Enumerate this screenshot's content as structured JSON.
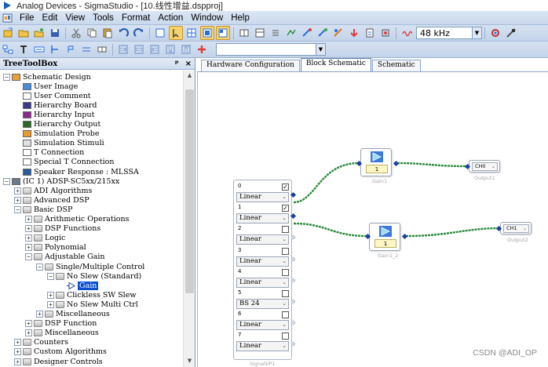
{
  "window": {
    "title": "Analog Devices - SigmaStudio - [10.线性增益.dspproj]"
  },
  "menu": [
    "File",
    "Edit",
    "View",
    "Tools",
    "Format",
    "Action",
    "Window",
    "Help"
  ],
  "toolbar": {
    "sample_rate": "48 kHz"
  },
  "left_panel": {
    "title": "TreeToolBox",
    "pin_label": "ᵖ",
    "close_label": "×",
    "tree": [
      {
        "label": "Schematic Design",
        "depth": 0,
        "exp": "-",
        "icon": "design-icon"
      },
      {
        "label": "User Image",
        "depth": 1,
        "exp": "",
        "icon": "image-icon"
      },
      {
        "label": "User Comment",
        "depth": 1,
        "exp": "",
        "icon": "comment-icon"
      },
      {
        "label": "Hierarchy Board",
        "depth": 1,
        "exp": "",
        "icon": "hierarchy-board-icon"
      },
      {
        "label": "Hierarchy Input",
        "depth": 1,
        "exp": "",
        "icon": "hierarchy-input-icon"
      },
      {
        "label": "Hierarchy Output",
        "depth": 1,
        "exp": "",
        "icon": "hierarchy-output-icon"
      },
      {
        "label": "Simulation Probe",
        "depth": 1,
        "exp": "",
        "icon": "probe-icon"
      },
      {
        "label": "Simulation Stimuli",
        "depth": 1,
        "exp": "",
        "icon": "stimuli-icon"
      },
      {
        "label": "T Connection",
        "depth": 1,
        "exp": "",
        "icon": "t-connection-icon"
      },
      {
        "label": "Special T Connection",
        "depth": 1,
        "exp": "",
        "icon": "t-connection-icon"
      },
      {
        "label": "Speaker Response : MLSSA",
        "depth": 1,
        "exp": "",
        "icon": "speaker-icon"
      },
      {
        "label": "(IC 1) ADSP-SC5xx/215xx",
        "depth": 0,
        "exp": "-",
        "icon": "chip-icon"
      },
      {
        "label": "ADI Algorithms",
        "depth": 1,
        "exp": "+",
        "icon": "folder-icon"
      },
      {
        "label": "Advanced DSP",
        "depth": 1,
        "exp": "+",
        "icon": "folder-icon"
      },
      {
        "label": "Basic DSP",
        "depth": 1,
        "exp": "-",
        "icon": "folder-icon"
      },
      {
        "label": "Arithmetic Operations",
        "depth": 2,
        "exp": "+",
        "icon": "folder-icon"
      },
      {
        "label": "DSP Functions",
        "depth": 2,
        "exp": "+",
        "icon": "folder-icon"
      },
      {
        "label": "Logic",
        "depth": 2,
        "exp": "+",
        "icon": "folder-icon"
      },
      {
        "label": "Polynomial",
        "depth": 2,
        "exp": "+",
        "icon": "folder-icon"
      },
      {
        "label": "Adjustable Gain",
        "depth": 2,
        "exp": "-",
        "icon": "folder-icon"
      },
      {
        "label": "Single/Multiple Control",
        "depth": 3,
        "exp": "-",
        "icon": "folder-icon"
      },
      {
        "label": "No Slew (Standard)",
        "depth": 4,
        "exp": "-",
        "icon": "folder-icon"
      },
      {
        "label": "Gain",
        "depth": 5,
        "exp": "",
        "icon": "gain-icon",
        "selected": true
      },
      {
        "label": "Clickless SW Slew",
        "depth": 4,
        "exp": "+",
        "icon": "folder-icon"
      },
      {
        "label": "No Slew Multi Ctrl",
        "depth": 4,
        "exp": "+",
        "icon": "folder-icon"
      },
      {
        "label": "Miscellaneous",
        "depth": 3,
        "exp": "+",
        "icon": "folder-icon"
      },
      {
        "label": "DSP Function",
        "depth": 2,
        "exp": "+",
        "icon": "folder-icon"
      },
      {
        "label": "Miscellaneous",
        "depth": 2,
        "exp": "+",
        "icon": "folder-icon"
      },
      {
        "label": "Counters",
        "depth": 1,
        "exp": "+",
        "icon": "folder-icon"
      },
      {
        "label": "Custom Algorithms",
        "depth": 1,
        "exp": "+",
        "icon": "folder-icon"
      },
      {
        "label": "Designer Controls",
        "depth": 1,
        "exp": "+",
        "icon": "folder-icon"
      }
    ]
  },
  "tabs": [
    {
      "label": "Hardware Configuration",
      "active": false
    },
    {
      "label": "Block Schematic",
      "active": true
    },
    {
      "label": "Schematic",
      "active": false
    }
  ],
  "schematic": {
    "signal_block": {
      "label": "SignalVP1",
      "channels": [
        {
          "num": "0",
          "value": "Linear",
          "checked": true
        },
        {
          "num": "1",
          "value": "Linear",
          "checked": true
        },
        {
          "num": "2",
          "value": "Linear",
          "checked": false
        },
        {
          "num": "3",
          "value": "Linear",
          "checked": false
        },
        {
          "num": "4",
          "value": "Linear",
          "checked": false
        },
        {
          "num": "5",
          "value": "BS 24",
          "checked": false
        },
        {
          "num": "6",
          "value": "Linear",
          "checked": false
        },
        {
          "num": "7",
          "value": "Linear",
          "checked": false
        }
      ]
    },
    "gain1": {
      "label": "Gain1",
      "value": "1"
    },
    "gain2": {
      "label": "Gain1_2",
      "value": "1"
    },
    "output1": {
      "label": "Output1",
      "channel": "CH0"
    },
    "output2": {
      "label": "Output2",
      "channel": "CH1"
    }
  },
  "watermark": "CSDN @ADI_OP",
  "colors": {
    "wire": "#2a8a3a",
    "selection": "#0a4fd3",
    "port": "#1a3e9b"
  }
}
